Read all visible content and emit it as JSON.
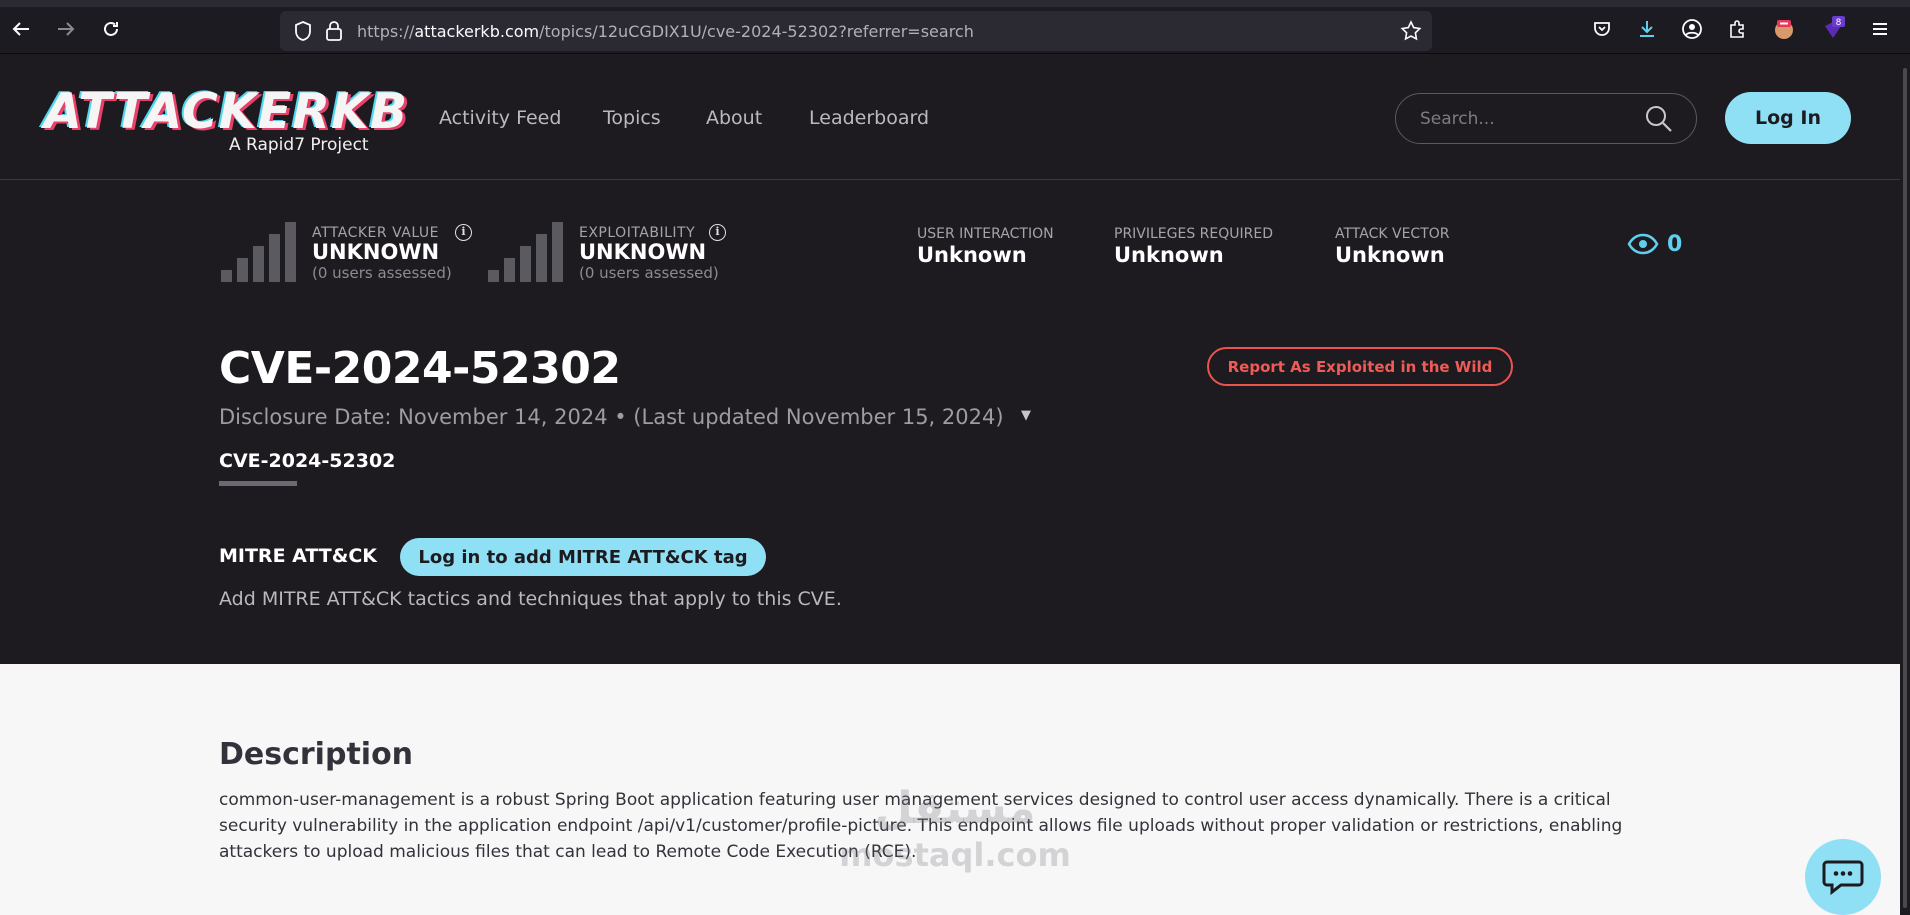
{
  "browser": {
    "url_prefix": "https://",
    "url_host": "attackerkb.com",
    "url_path": "/topics/12uCGDIX1U/cve-2024-52302?referrer=search",
    "extension_badge": "8"
  },
  "header": {
    "logo_text": "ATTACKERKB",
    "logo_sub": "A Rapid7 Project",
    "nav": [
      "Activity Feed",
      "Topics",
      "About",
      "Leaderboard"
    ],
    "search_placeholder": "Search...",
    "login_label": "Log In"
  },
  "stats": {
    "attacker_value": {
      "label": "ATTACKER VALUE",
      "value": "UNKNOWN",
      "sub": "(0 users assessed)"
    },
    "exploitability": {
      "label": "EXPLOITABILITY",
      "value": "UNKNOWN",
      "sub": "(0 users assessed)"
    },
    "user_interaction": {
      "label": "USER INTERACTION",
      "value": "Unknown"
    },
    "privileges_required": {
      "label": "PRIVILEGES REQUIRED",
      "value": "Unknown"
    },
    "attack_vector": {
      "label": "ATTACK VECTOR",
      "value": "Unknown"
    },
    "views": "0"
  },
  "topic": {
    "title": "CVE-2024-52302",
    "report_label": "Report As Exploited in the Wild",
    "disclosure": "Disclosure Date: November 14, 2024 • (Last updated November 15, 2024)",
    "tab": "CVE-2024-52302"
  },
  "mitre": {
    "label": "MITRE ATT&CK",
    "button": "Log in to add MITRE ATT&CK tag",
    "help": "Add MITRE ATT&CK tactics and techniques that apply to this CVE."
  },
  "description": {
    "heading": "Description",
    "body": "common-user-management is a robust Spring Boot application featuring user management services designed to control user access dynamically. There is a critical security vulnerability in the application endpoint /api/v1/customer/profile-picture. This endpoint allows file uploads without proper validation or restrictions, enabling attackers to upload malicious files that can lead to Remote Code Execution (RCE)."
  },
  "watermark": {
    "ar": "مستقل",
    "en": "mostaql.com"
  },
  "colors": {
    "accent": "#8fe0f5",
    "danger": "#e9544f",
    "dark_bg": "#1d1b20",
    "light_bg": "#f7f7f7"
  }
}
